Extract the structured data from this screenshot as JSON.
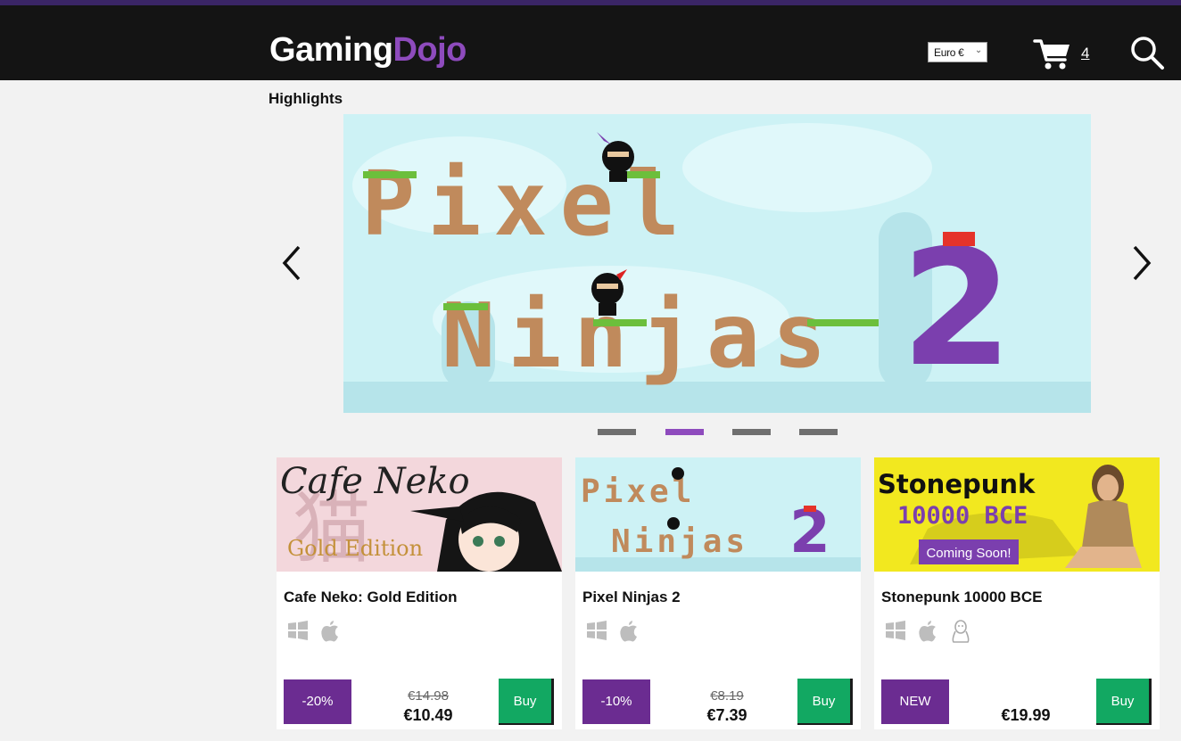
{
  "header": {
    "logo_white": "Gaming",
    "logo_purple": "Dojo",
    "currency": "Euro €",
    "cart_count": "4"
  },
  "highlights": {
    "title": "Highlights",
    "banner_line1": "Pixel",
    "banner_line2": "Ninjas",
    "banner_number": "2",
    "active_slide": 2,
    "slide_count": 4
  },
  "products": [
    {
      "name": "Cafe Neko: Gold Edition",
      "thumb_title": "Cafe Neko",
      "thumb_subtitle": "Gold Edition",
      "thumb_kanji": "猫",
      "platforms": [
        "windows-icon",
        "apple-icon"
      ],
      "badge": "-20%",
      "old_price": "€14.98",
      "price": "€10.49",
      "buy_label": "Buy"
    },
    {
      "name": "Pixel Ninjas 2",
      "thumb_line1": "Pixel",
      "thumb_line2": "Ninjas",
      "thumb_number": "2",
      "platforms": [
        "windows-icon",
        "apple-icon"
      ],
      "badge": "-10%",
      "old_price": "€8.19",
      "price": "€7.39",
      "buy_label": "Buy"
    },
    {
      "name": "Stonepunk 10000 BCE",
      "thumb_title": "Stonepunk",
      "thumb_subtitle": "10000 BCE",
      "thumb_tag": "Coming Soon!",
      "platforms": [
        "windows-icon",
        "apple-icon",
        "linux-icon"
      ],
      "badge": "NEW",
      "old_price": "",
      "price": "€19.99",
      "buy_label": "Buy"
    }
  ],
  "colors": {
    "brand_purple": "#8e4bbd",
    "badge_purple": "#6b2c91",
    "buy_green": "#12a862",
    "header_bg": "#141414"
  }
}
